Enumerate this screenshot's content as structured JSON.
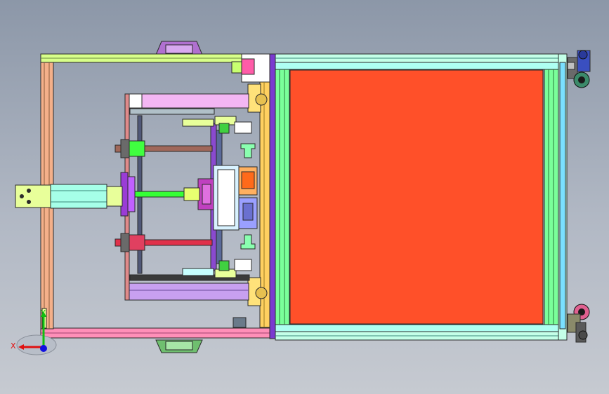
{
  "viewer": {
    "triad": {
      "x_label": "X",
      "y_label": "Y"
    }
  },
  "colors": {
    "panel_fill": "#ff5029",
    "frame_green": "#9bff9b",
    "frame_yellow": "#e8ff8a",
    "frame_pink": "#ff7ab0",
    "frame_cyan": "#a8ffff",
    "purple": "#9a3cd6",
    "mold_magenta": "#c040c0",
    "rod_green": "#35ff35",
    "rod_red": "#e0304a",
    "rod_brown": "#9b5a4a",
    "axis_x": "#e01010",
    "axis_y": "#10c010",
    "axis_z": "#1010e0"
  },
  "icons": {
    "triad": "coordinate-triad-icon",
    "caster": "caster-wheel-icon",
    "handle": "handle-icon"
  }
}
